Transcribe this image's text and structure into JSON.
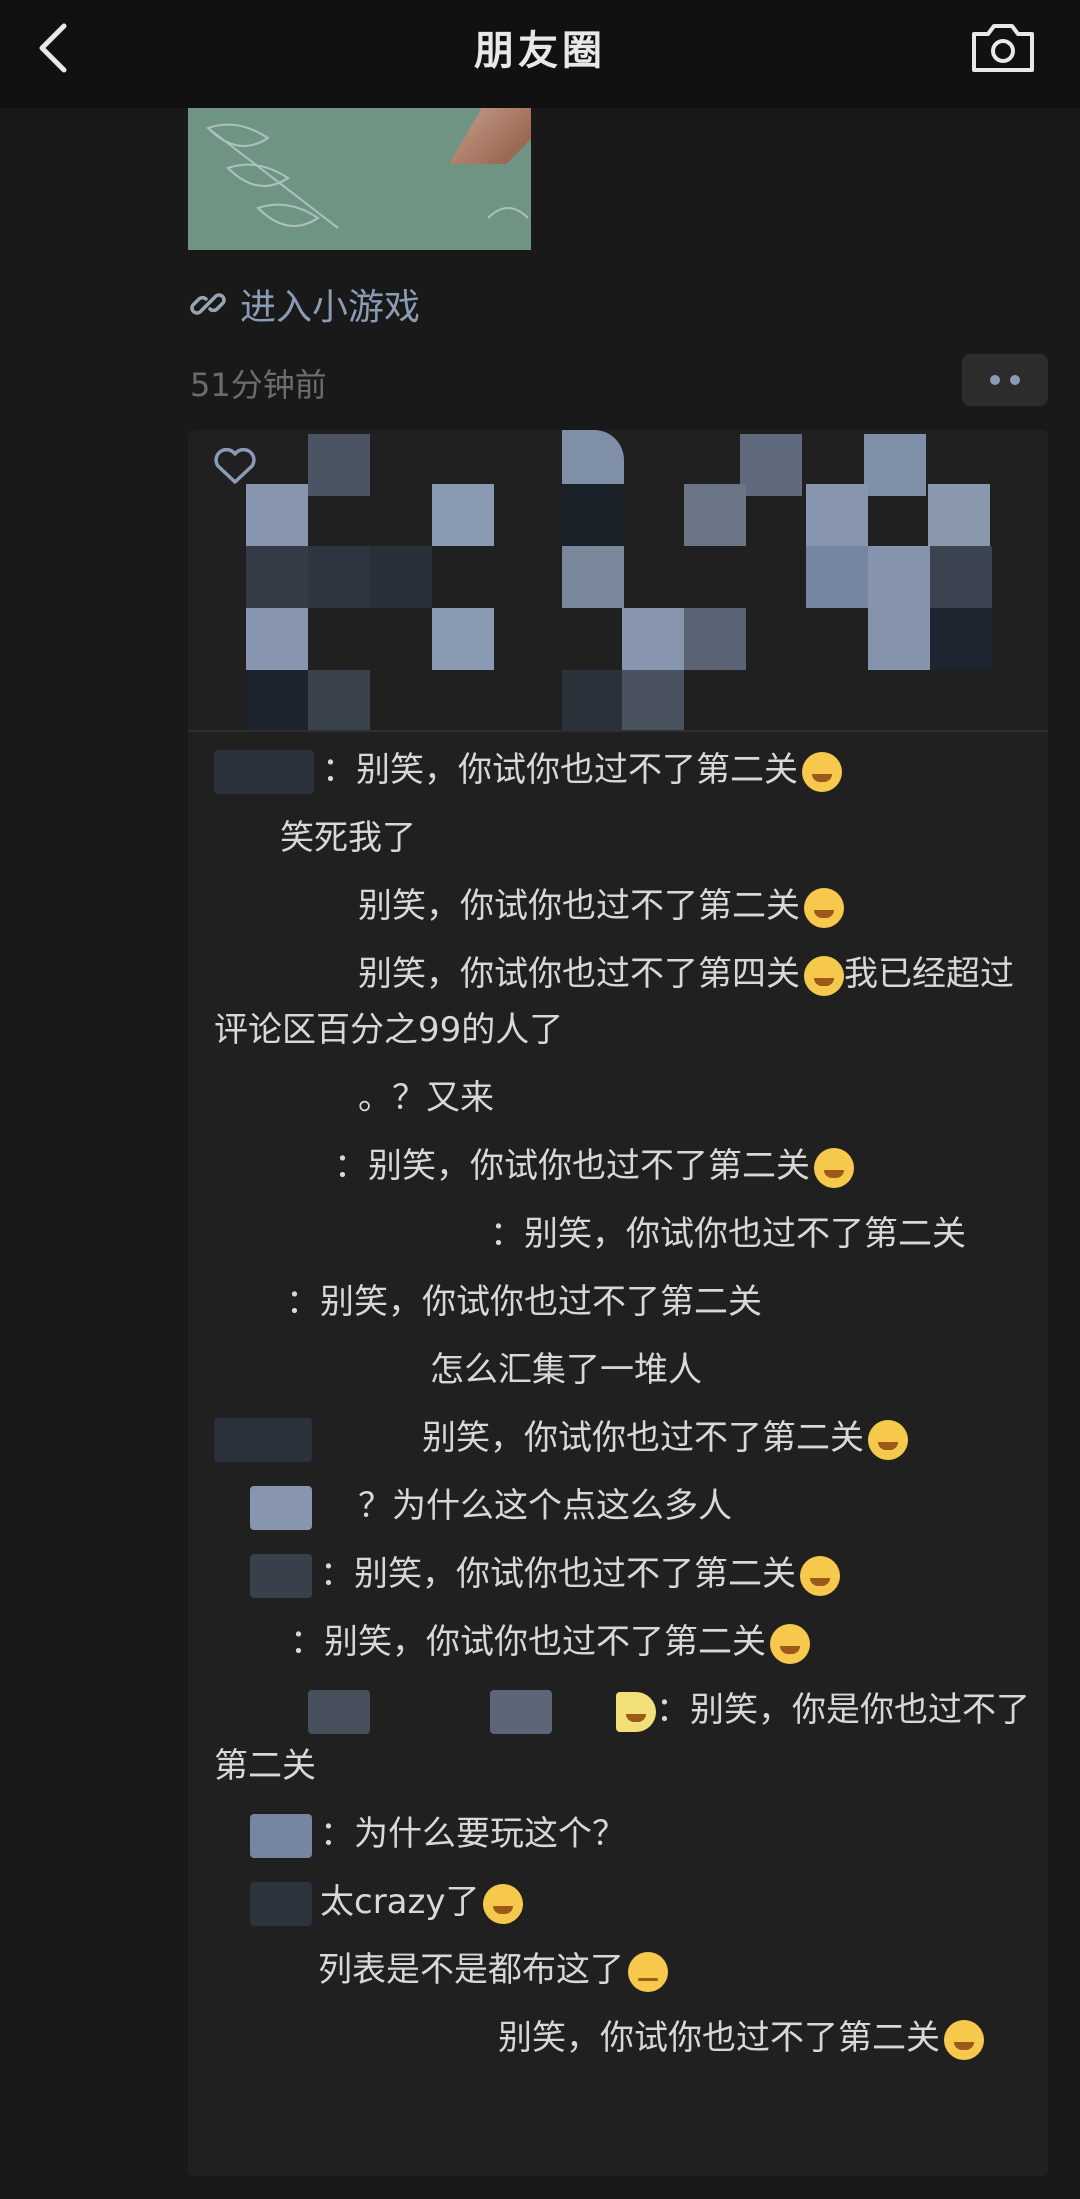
{
  "header": {
    "title": "朋友圈",
    "back_icon": "chevron-left-icon",
    "camera_icon": "camera-icon"
  },
  "post": {
    "link_icon": "link-icon",
    "link_label": "进入小游戏",
    "time": "51分钟前",
    "more_icon": "more-dots-icon"
  },
  "likes": {
    "heart_icon": "heart-icon"
  },
  "comments": [
    {
      "text": "：别笑，你试你也过不了第二关",
      "emoji": "face-with-tears-of-joy"
    },
    {
      "text": "笑死我了",
      "emoji": ""
    },
    {
      "text": "别笑，你试你也过不了第二关",
      "emoji": "face-with-tears-of-joy"
    },
    {
      "text": "别笑，你试你也过不了第四关",
      "emoji": "face-with-tears-of-joy",
      "tail": "我已经超过评论区百分之99的人了"
    },
    {
      "text": "。？又来",
      "emoji": ""
    },
    {
      "text": "：别笑，你试你也过不了第二关",
      "emoji": "face-with-tears-of-joy"
    },
    {
      "text": "：别笑，你试你也过不了第二关",
      "emoji": ""
    },
    {
      "text": "：别笑，你试你也过不了第二关",
      "emoji": ""
    },
    {
      "text": "怎么汇集了一堆人",
      "emoji": ""
    },
    {
      "text": "别笑，你试你也过不了第二关",
      "emoji": "face-with-tears-of-joy"
    },
    {
      "text": "？为什么这个点这么多人",
      "emoji": ""
    },
    {
      "text": "：别笑，你试你也过不了第二关",
      "emoji": "face-with-tears-of-joy"
    },
    {
      "text": "：别笑，你试你也过不了第二关",
      "emoji": "face-with-tears-of-joy"
    },
    {
      "text": "：别笑，你是你也过不了第二关",
      "emoji": ""
    },
    {
      "text": "：为什么要玩这个？",
      "emoji": ""
    },
    {
      "text": "太crazy了",
      "emoji": "face-with-tears-of-joy"
    },
    {
      "text": "列表是不是都布这了",
      "emoji": "pensive-face"
    },
    {
      "text": "别笑，你试你也过不了第二关",
      "emoji": "face-with-tears-of-joy"
    }
  ]
}
